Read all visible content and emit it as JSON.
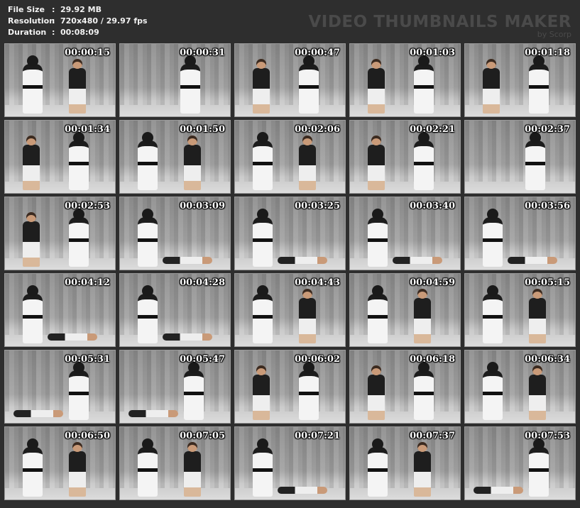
{
  "info": {
    "file_size_label": "File Size",
    "file_size_value": "29.92 MB",
    "resolution_label": "Resolution",
    "resolution_value": "720x480 / 29.97 fps",
    "duration_label": "Duration",
    "duration_value": "00:08:09",
    "separator": ":"
  },
  "watermark": {
    "title": "VIDEO THUMBNAILS MAKER",
    "subtitle": "by Scorp"
  },
  "thumbnails": [
    {
      "time": "00:00:15",
      "scene": "wm"
    },
    {
      "time": "00:00:31",
      "scene": "w"
    },
    {
      "time": "00:00:47",
      "scene": "mw"
    },
    {
      "time": "00:01:03",
      "scene": "mw"
    },
    {
      "time": "00:01:18",
      "scene": "mw"
    },
    {
      "time": "00:01:34",
      "scene": "mw"
    },
    {
      "time": "00:01:50",
      "scene": "wm"
    },
    {
      "time": "00:02:06",
      "scene": "wm"
    },
    {
      "time": "00:02:21",
      "scene": "mw"
    },
    {
      "time": "00:02:37",
      "scene": "w"
    },
    {
      "time": "00:02:53",
      "scene": "mw"
    },
    {
      "time": "00:03:09",
      "scene": "wl"
    },
    {
      "time": "00:03:25",
      "scene": "wl"
    },
    {
      "time": "00:03:40",
      "scene": "wl"
    },
    {
      "time": "00:03:56",
      "scene": "wl"
    },
    {
      "time": "00:04:12",
      "scene": "wl"
    },
    {
      "time": "00:04:28",
      "scene": "wl"
    },
    {
      "time": "00:04:43",
      "scene": "wm"
    },
    {
      "time": "00:04:59",
      "scene": "wm"
    },
    {
      "time": "00:05:15",
      "scene": "wm"
    },
    {
      "time": "00:05:31",
      "scene": "lw"
    },
    {
      "time": "00:05:47",
      "scene": "lw"
    },
    {
      "time": "00:06:02",
      "scene": "mw"
    },
    {
      "time": "00:06:18",
      "scene": "mw"
    },
    {
      "time": "00:06:34",
      "scene": "wm"
    },
    {
      "time": "00:06:50",
      "scene": "wm"
    },
    {
      "time": "00:07:05",
      "scene": "wm"
    },
    {
      "time": "00:07:21",
      "scene": "wl"
    },
    {
      "time": "00:07:37",
      "scene": "wm"
    },
    {
      "time": "00:07:53",
      "scene": "lw"
    }
  ]
}
